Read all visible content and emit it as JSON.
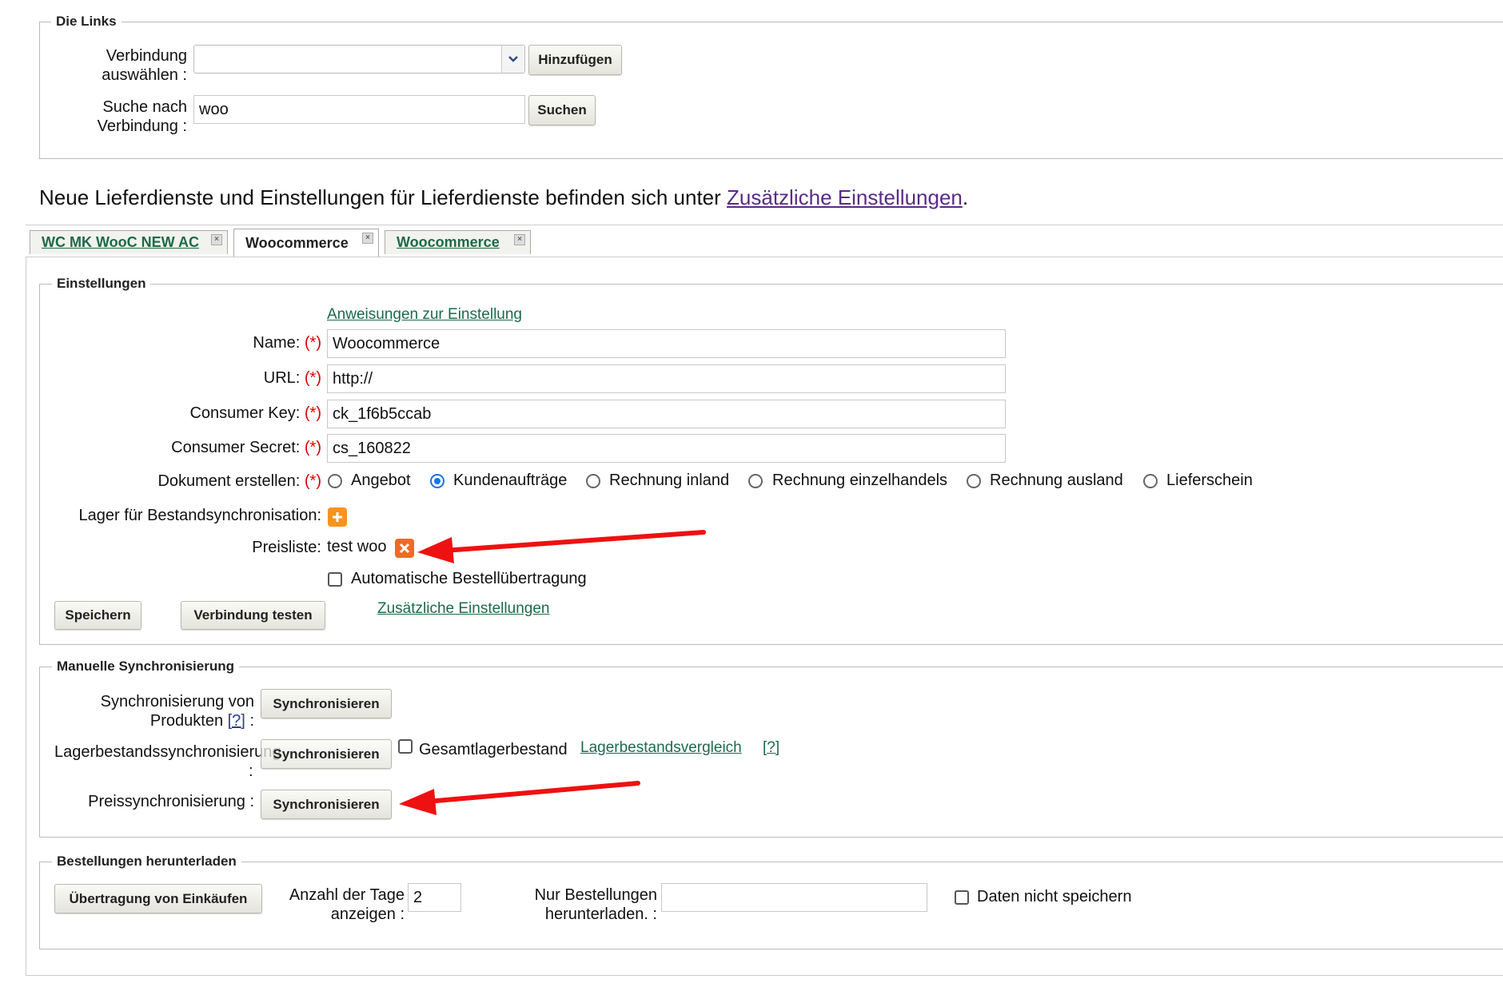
{
  "links": {
    "legend": "Die Links",
    "select_label": "Verbindung auswählen :",
    "add_button": "Hinzufügen",
    "search_label": "Suche nach Verbindung :",
    "search_value": "woo",
    "search_button": "Suchen"
  },
  "notice": {
    "text": "Neue Lieferdienste und Einstellungen für Lieferdienste befinden sich unter ",
    "link": "Zusätzliche Einstellungen",
    "end": "."
  },
  "tabs": [
    {
      "label": "WC MK WooC NEW AC",
      "active": false
    },
    {
      "label": "Woocommerce",
      "active": true
    },
    {
      "label": "Woocommerce",
      "active": false
    }
  ],
  "settings": {
    "legend": "Einstellungen",
    "instructions_link": "Anweisungen zur Einstellung",
    "required_mark": "(*)",
    "name_label": "Name:",
    "name_value": "Woocommerce",
    "url_label": "URL:",
    "url_value": "http://",
    "key_label": "Consumer Key:",
    "key_value": "ck_1f6b5ccab",
    "secret_label": "Consumer Secret:",
    "secret_value": "cs_160822",
    "doc_label": "Dokument erstellen:",
    "doc_options": [
      "Angebot",
      "Kundenaufträge",
      "Rechnung inland",
      "Rechnung einzelhandels",
      "Rechnung ausland",
      "Lieferschein"
    ],
    "doc_selected": "Kundenaufträge",
    "warehouse_label": "Lager für Bestandsynchronisation:",
    "pricelist_label": "Preisliste:",
    "pricelist_value": "test woo",
    "auto_transfer_label": "Automatische Bestellübertragung",
    "auto_transfer_checked": false,
    "save_button": "Speichern",
    "test_button": "Verbindung testen",
    "extra_link": "Zusätzliche Einstellungen"
  },
  "manual_sync": {
    "legend": "Manuelle Synchronisierung",
    "products_label": "Synchronisierung von Produkten",
    "help": "[?]",
    "colon": ":",
    "stock_label": "Lagerbestandssynchronisierung",
    "price_label": "Preissynchronisierung :",
    "sync_button": "Synchronisieren",
    "total_stock_label": "Gesamtlagerbestand",
    "total_stock_checked": false,
    "compare_link": "Lagerbestandsvergleich"
  },
  "orders": {
    "legend": "Bestellungen herunterladen",
    "transfer_button": "Übertragung von Einkäufen",
    "days_label": "Anzahl der Tage anzeigen :",
    "days_value": "2",
    "only_label": "Nur Bestellungen herunterladen. :",
    "only_value": "",
    "nosave_label": "Daten nicht speichern",
    "nosave_checked": false
  },
  "colors": {
    "link": "#1c6a4a",
    "notice_link": "#5b2a86",
    "required": "#dd0000",
    "annotation_arrow": "#ee1111",
    "radio_active": "#1a73e8"
  }
}
